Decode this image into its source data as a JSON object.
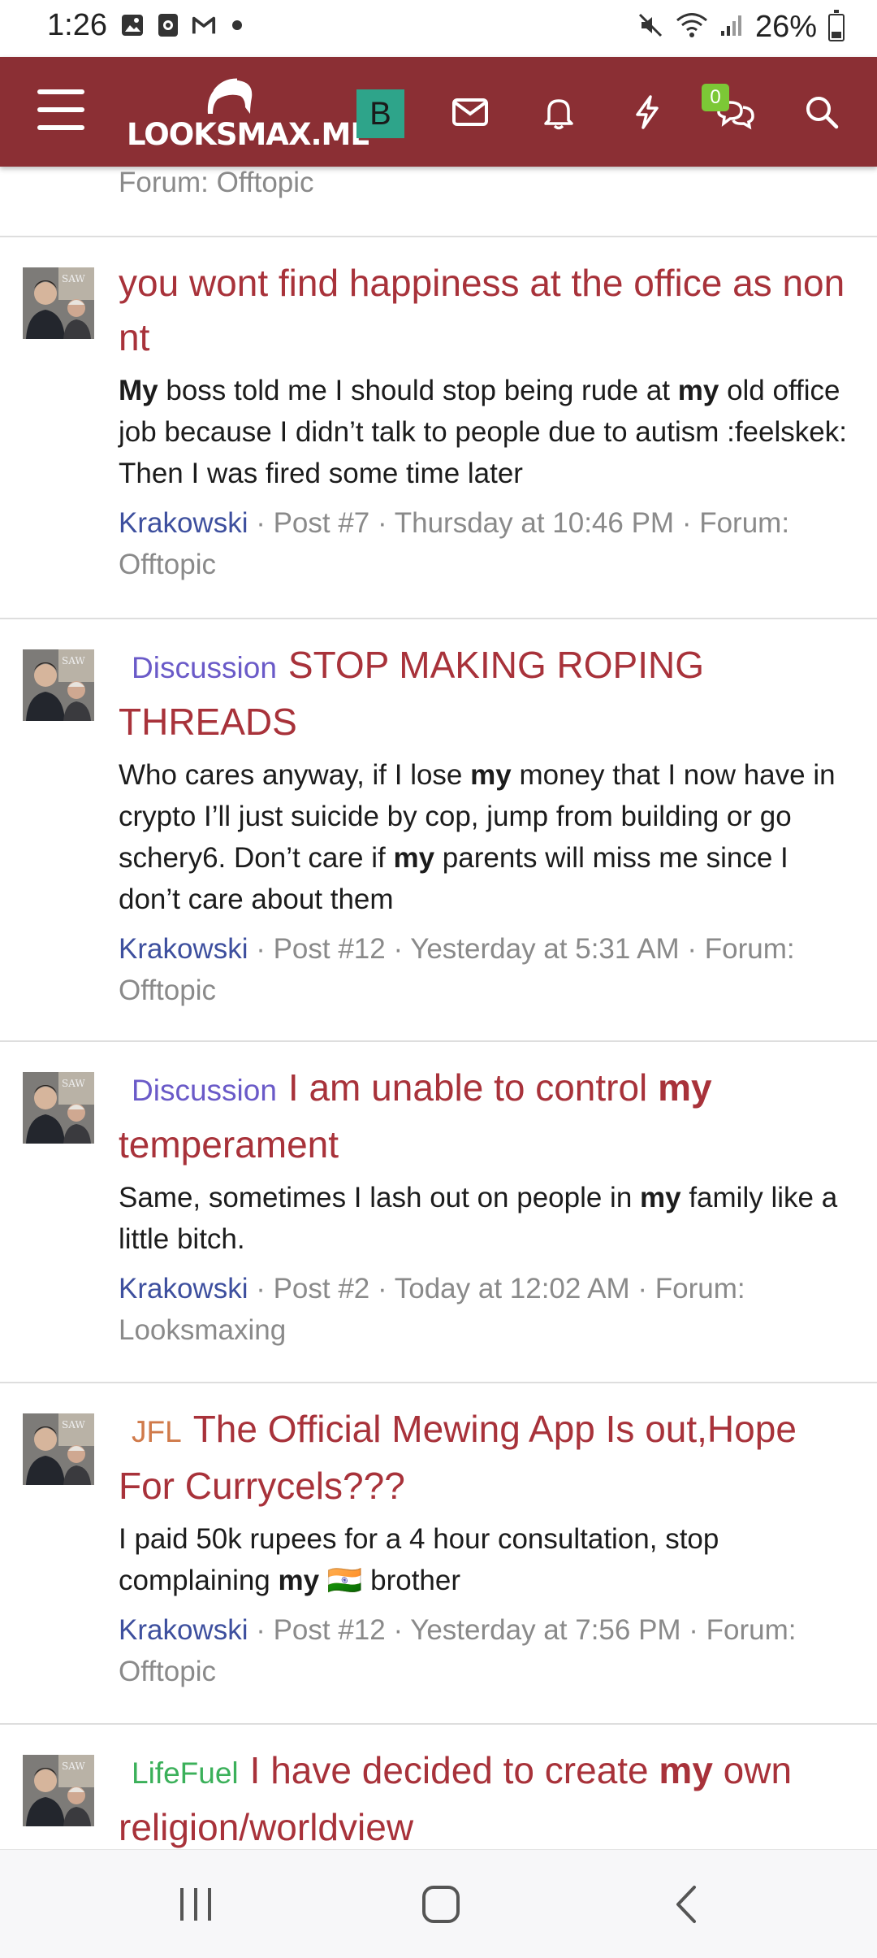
{
  "status_bar": {
    "time": "1:26",
    "battery": "26%",
    "left_icons": [
      "gallery-icon",
      "screen-record-icon",
      "gmail-icon",
      "dot-icon"
    ],
    "right_icons": [
      "mute-icon",
      "wifi-icon",
      "signal-icon",
      "battery-icon"
    ]
  },
  "header": {
    "logo_text": "LOOKSMAX.ME",
    "user_initial": "B",
    "conversations_badge": "0",
    "colors": {
      "header_bg": "#8b2f34",
      "avatar_bg": "#2ea48a",
      "badge_bg": "#7cc836"
    }
  },
  "prev_result": {
    "forum": "Forum: Offtopic"
  },
  "results": [
    {
      "prefix": "",
      "title": "you wont find happiness at the office as non nt",
      "snippet_html": "<b>My</b> boss told me I should stop being rude at <b>my</b> old office job because I didn’t talk to people due to autism :feelskek: Then I was fired some time later",
      "author": "Krakowski",
      "meta": " · Post #7 · Thursday at 10:46 PM · Forum: Offtopic"
    },
    {
      "prefix": "Discussion",
      "title": "STOP MAKING ROPING THREADS",
      "snippet_html": "Who cares anyway, if I lose <b>my</b> money that I now have in crypto I’ll just suicide by cop, jump from building or go schery6. Don’t care if <b>my</b> parents will miss me since I don’t care about them",
      "author": "Krakowski",
      "meta": " · Post #12 · Yesterday at 5:31 AM · Forum: Offtopic"
    },
    {
      "prefix": "Discussion",
      "title_html": "I am unable to control <b>my</b> temperament",
      "snippet_html": "Same, sometimes I lash out on people in <b>my</b> family like a little bitch.",
      "author": "Krakowski",
      "meta": " · Post #2 · Today at 12:02 AM · Forum: Looksmaxing"
    },
    {
      "prefix": "JFL",
      "title": "The Official Mewing App Is out,Hope For Currycels???",
      "snippet_html": "I paid 50k rupees for a 4 hour consultation, stop complaining <b>my</b> 🇮🇳 brother",
      "author": "Krakowski",
      "meta": " · Post #12 · Yesterday at 7:56 PM · Forum: Offtopic"
    },
    {
      "prefix": "LifeFuel",
      "title_html": "I have decided to create <b>my</b> own religion/worldview"
    }
  ]
}
